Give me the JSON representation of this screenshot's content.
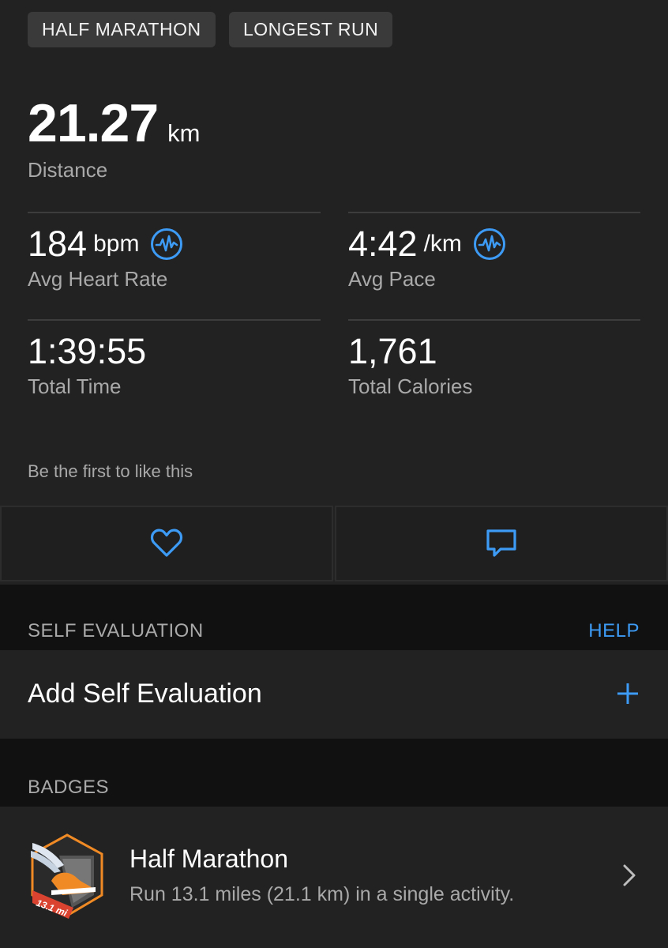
{
  "tags": [
    "HALF MARATHON",
    "LONGEST RUN"
  ],
  "distance": {
    "value": "21.27",
    "unit": "km",
    "label": "Distance"
  },
  "stats": {
    "heart_rate": {
      "value": "184",
      "unit": "bpm",
      "label": "Avg Heart Rate",
      "icon": "heart-rate-chart-icon"
    },
    "pace": {
      "value": "4:42",
      "unit": "/km",
      "label": "Avg Pace",
      "icon": "pace-chart-icon"
    },
    "time": {
      "value": "1:39:55",
      "label": "Total Time"
    },
    "calories": {
      "value": "1,761",
      "label": "Total Calories"
    }
  },
  "social": {
    "likes_text": "Be the first to like this",
    "like_icon": "heart-icon",
    "comment_icon": "comment-icon"
  },
  "self_evaluation": {
    "header": "SELF EVALUATION",
    "help": "HELP",
    "add_label": "Add Self Evaluation",
    "add_icon": "plus-icon"
  },
  "badges": {
    "header": "BADGES",
    "items": [
      {
        "title": "Half Marathon",
        "description": "Run 13.1 miles (21.1 km) in a single activity.",
        "badge_text": "13.1 mi",
        "icon": "half-marathon-badge-icon"
      }
    ]
  },
  "colors": {
    "accent": "#3d9bf5",
    "card": "#222222",
    "background": "#111111",
    "chip": "#3a3a3a",
    "secondary_text": "#a9a9a9",
    "badge_orange": "#f08a24"
  }
}
